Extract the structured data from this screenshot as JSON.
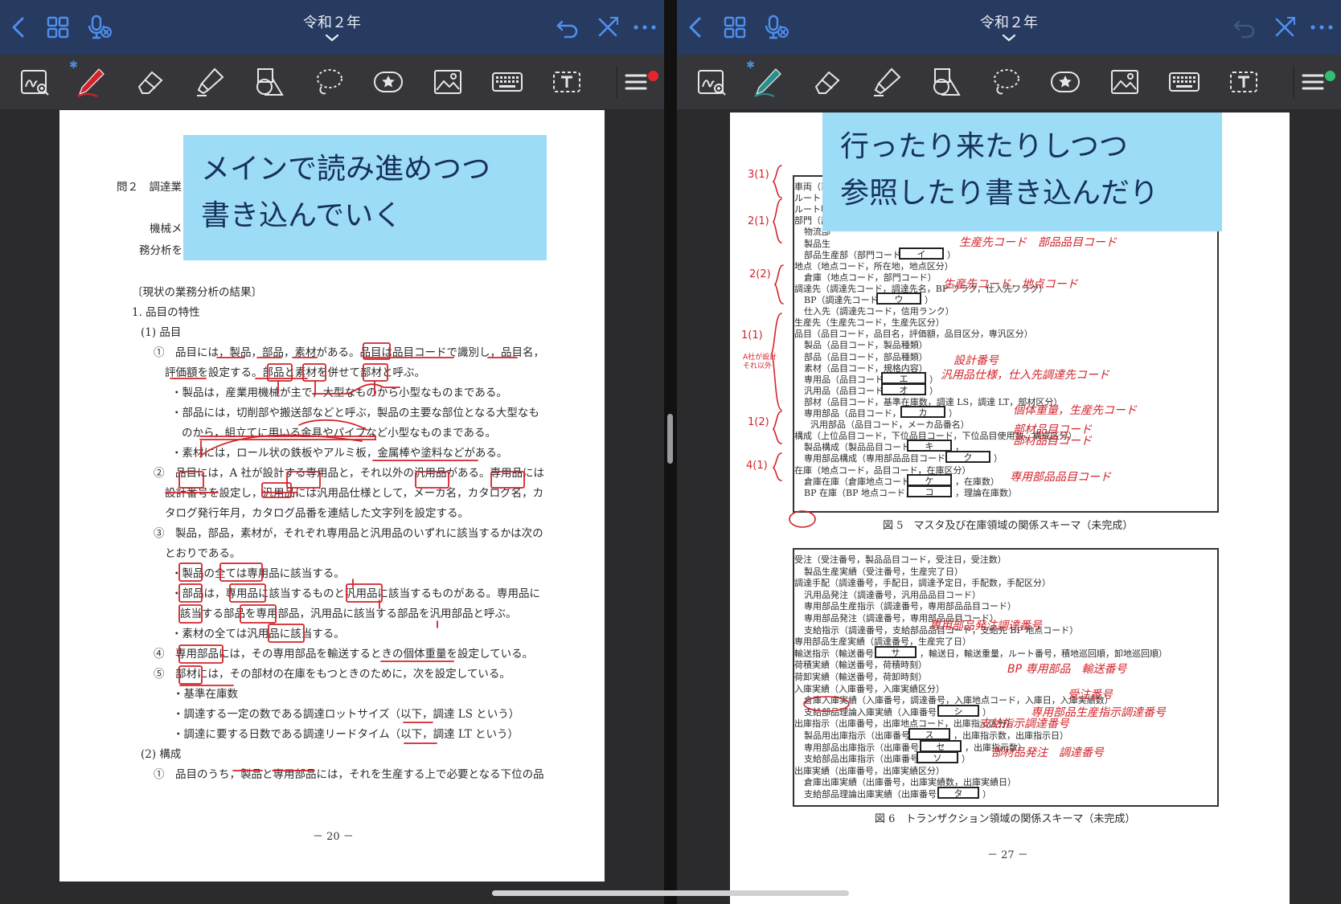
{
  "left": {
    "title": "令和２年",
    "active_pen_color": "#d3232a",
    "status_dot_color": "#e8252b",
    "callout": {
      "line1": "メインで読み進めつつ",
      "line2": "書き込んでいく"
    },
    "doc": {
      "heading": "問２　調達業",
      "intro1": "機械メ",
      "intro2": "務分析を",
      "section": "〔現状の業務分析の結果〕",
      "lines": [
        "1.  品目の特性",
        "(1)  品目",
        "①　品目には，製品，部品，素材がある。品目は品目コードで識別し，品目名，",
        "評価額を設定する。部品と素材を併せて部材と呼ぶ。",
        "・製品は，産業用機械が主で，大型なものから小型なものまである。",
        "・部品には，切削部や搬送部などと呼ぶ，製品の主要な部位となる大型なも",
        "のから，組立てに用いる金具やパイプなど小型なものまである。",
        "・素材には，ロール状の鉄板やアルミ板，金属棒や塗料などがある。",
        "②　品目には，A 社が設計する専用品と，それ以外の汎用品がある。専用品には",
        "設計番号を設定し，汎用品には汎用品仕様として，メーカ名，カタログ名，カ",
        "タログ発行年月，カタログ品番を連結した文字列を設定する。",
        "③　製品，部品，素材が，それぞれ専用品と汎用品のいずれに該当するかは次の",
        "とおりである。",
        "・製品の全ては専用品に該当する。",
        "・部品は，専用品に該当するものと汎用品に該当するものがある。専用品に",
        "該当する部品を専用部品，汎用品に該当する部品を汎用部品と呼ぶ。",
        "・素材の全ては汎用品に該当する。",
        "④　専用部品には，その専用部品を輸送するときの個体重量を設定している。",
        "⑤　部材には，その部材の在庫をもつときのために，次を設定している。",
        "・基準在庫数",
        "・調達する一定の数である調達ロットサイズ（以下，調達 LS という）",
        "・調達に要する日数である調達リードタイム（以下，調達 LT という）",
        "(2)  構成",
        "①　品目のうち，製品と専用部品には，それを生産する上で必要となる下位の品"
      ],
      "page_number": "－ 20 －"
    }
  },
  "right": {
    "title": "令和２年",
    "active_pen_color": "#2a8f8a",
    "status_dot_color": "#2fbf71",
    "callout": {
      "line1": "行ったり来たりしつつ",
      "line2": "参照したり書き込んだり"
    },
    "fig5": {
      "rows": [
        "車両（車",
        "ルート（",
        "ルート明",
        "部門（部",
        "物流部",
        "製品生",
        "部品生産部（部門コード，",
        "地点（地点コード，所在地，地点区分）",
        "倉庫（地点コード，部門コード）",
        "調達先（調達先コード，調達先名，BP フラグ，仕入先フラグ）",
        "BP（調達先コード，",
        "仕入先（調達先コード，信用ランク）",
        "生産先（生産先コード，生産先区分）",
        "品目（品目コード，品目名，評価額，品目区分，専汎区分）",
        "製品（品目コード，製品種類）",
        "部品（品目コード，部品種類）",
        "素材（品目コード，規格内容）",
        "専用品（品目コード，",
        "汎用品（品目コード，",
        "部材（品目コード，基準在庫数，調達 LS，調達 LT，部材区分）",
        "専用部品（品目コード，",
        "汎用部品（品目コード，メーカ品番名）",
        "構成（上位品目コード，下位品目コード，下位品目使用数，構成区分）",
        "製品構成（製品品目コード，",
        "専用部品構成（専用部品品目コード，",
        "在庫（地点コード，品目コード，在庫区分）",
        "倉庫在庫（倉庫地点コード，",
        "BP 在庫（BP 地点コード，"
      ],
      "boxes": [
        "イ",
        "ウ",
        "エ",
        "オ",
        "カ",
        "キ",
        "ク",
        "ケ",
        "コ"
      ],
      "tails": [
        "）",
        "）",
        "）",
        "）",
        "）",
        "，",
        "）",
        "，在庫数）",
        "，理論在庫数）"
      ],
      "caption": "図 5　マスタ及び在庫領域の関係スキーマ（未完成）"
    },
    "fig6": {
      "rows": [
        "受注（受注番号，製品品目コード，受注日，受注数）",
        "製品生産実績（受注番号，生産完了日）",
        "調達手配（調達番号，手配日，調達予定日，手配数，手配区分）",
        "汎用品発注（調達番号，汎用品品目コード）",
        "専用部品生産指示（調達番号，専用部品品目コード）",
        "専用部品発注（調達番号，専用部品品目コード）",
        "支給指示（調達番号，支給部品品目コード，支給先 BP 地点コード）",
        "専用部品生産実績（調達番号，生産完了日）",
        "輸送指示（輸送番号，",
        "荷積実績（輸送番号，荷積時刻）",
        "荷卸実績（輸送番号，荷卸時刻）",
        "入庫実績（入庫番号，入庫実績区分）",
        "倉庫入庫実績（入庫番号，調達番号，入庫地点コード，入庫日，入庫実績数）",
        "支給部品理論入庫実績（入庫番号，",
        "出庫指示（出庫番号，出庫地点コード，出庫指示区分）",
        "製品用出庫指示（出庫番号，",
        "専用部品出庫指示（出庫番号，",
        "支給部品出庫指示（出庫番号，",
        "出庫実績（出庫番号，出庫実績区分）",
        "倉庫出庫実績（出庫番号，出庫実績数，出庫実績日）",
        "支給部品理論出庫実績（出庫番号，"
      ],
      "boxes": [
        "サ",
        "シ",
        "ス",
        "セ",
        "ソ",
        "タ"
      ],
      "tails": [
        "，輸送日，輸送重量，ルート番号，積地巡回順，卸地巡回順）",
        "）",
        "，出庫指示数，出庫指示日）",
        "，出庫指示数）",
        "）",
        "）"
      ],
      "caption": "図 6　トランザクション領域の関係スキーマ（未完成）"
    },
    "annotations": {
      "fig5": [
        "生産先コード　部品品目コード",
        "生産先コード，地点コード",
        "設計番号",
        "汎用品仕様，仕入先調達先コード",
        "個体重量，生産先コード",
        "部材品目コード",
        "部材品目コード",
        "専用部品品目コード"
      ],
      "fig6": [
        "専用部品発注調達番号",
        "BP 専用部品　輸送番号",
        "受注番号",
        "専用部品生産指示調達番号",
        "支給指示調達番号",
        "部材品発注　調達番号"
      ],
      "margin": [
        "3(1)",
        "2(1)",
        "2(2)",
        "1(1)",
        "1(2)",
        "4(1)",
        "A社が設計\nそれ以外"
      ]
    },
    "page_number": "－ 27 －"
  }
}
